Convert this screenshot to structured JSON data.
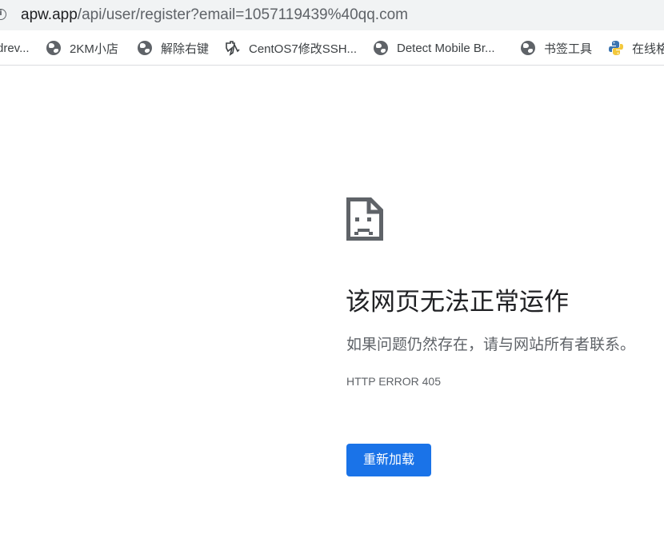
{
  "address_bar": {
    "url_host": "apw.app",
    "url_path": "/api/user/register?email=1057119439%40qq.com"
  },
  "bookmarks": [
    {
      "label": "drev...",
      "icon": "none"
    },
    {
      "label": "2KM小店",
      "icon": "globe-icon"
    },
    {
      "label": "解除右键",
      "icon": "globe-icon"
    },
    {
      "label": "CentOS7修改SSH...",
      "icon": "puzzle-icon"
    },
    {
      "label": "Detect Mobile Br...",
      "icon": "globe-icon"
    },
    {
      "label": "书签工具",
      "icon": "globe-icon"
    },
    {
      "label": "在线格",
      "icon": "python-icon"
    }
  ],
  "error": {
    "title": "该网页无法正常运作",
    "message": "如果问题仍然存在，请与网站所有者联系。",
    "code": "HTTP ERROR 405",
    "reload_label": "重新加载",
    "accent_color": "#1a73e8",
    "icon": "sad-document-icon"
  }
}
